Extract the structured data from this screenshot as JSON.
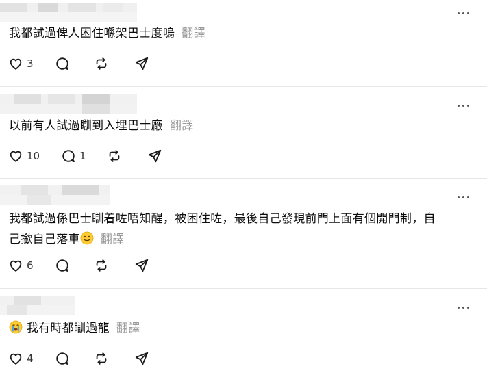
{
  "posts": [
    {
      "username_hidden": true,
      "text": "我都試過俾人困住喺架巴士度嗚",
      "translate_label": "翻譯",
      "like_count": "3",
      "reply_count": "",
      "emoji": ""
    },
    {
      "username_hidden": true,
      "text": "以前有人試過瞓到入埋巴士廠",
      "translate_label": "翻譯",
      "like_count": "10",
      "reply_count": "1",
      "emoji": ""
    },
    {
      "username_hidden": true,
      "text_line1": "我都試過係巴士瞓着咗唔知醒，被困住咗，最後自己發現前門上面有個開門制，自",
      "text_line2": "己撳自己落車",
      "emoji": "slightly-smiling-face",
      "translate_label": "翻譯",
      "like_count": "6",
      "reply_count": ""
    },
    {
      "username_hidden": true,
      "emoji": "crying-face",
      "text": "我有時都瞓過龍",
      "translate_label": "翻譯",
      "like_count": "4",
      "reply_count": ""
    }
  ],
  "icons": {
    "like": "heart-icon",
    "reply": "comment-icon",
    "repost": "repost-icon",
    "share": "send-icon",
    "more": "more-horizontal-icon"
  },
  "colors": {
    "translate": "#999999",
    "icon": "#1a1a1a",
    "divider": "#e6e6e6"
  }
}
